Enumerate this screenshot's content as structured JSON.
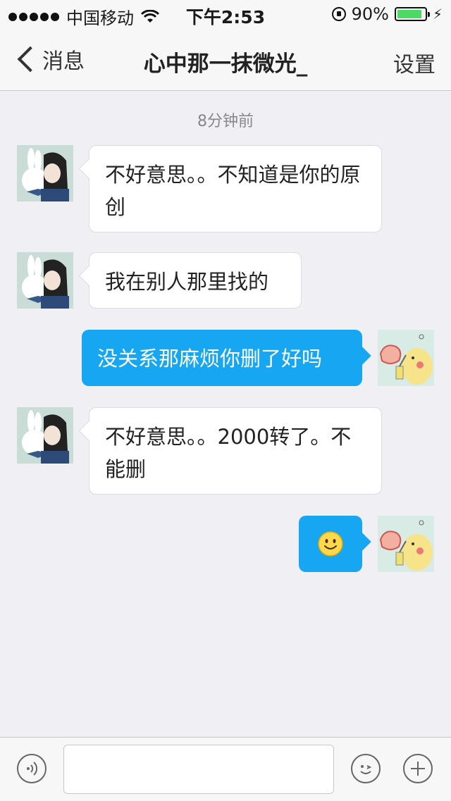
{
  "status_bar": {
    "carrier": "中国移动",
    "time": "下午2:53",
    "battery_percent": "90%",
    "battery_level": 0.9
  },
  "nav": {
    "back_label": "消息",
    "title": "心中那一抹微光_",
    "right_label": "设置"
  },
  "chat": {
    "timestamp": "8分钟前",
    "messages": [
      {
        "side": "in",
        "text": "不好意思。。不知道是你的原创"
      },
      {
        "side": "in",
        "text": "我在别人那里找的"
      },
      {
        "side": "out",
        "text": "没关系那麻烦你删了好吗"
      },
      {
        "side": "in",
        "text": "不好意思。。2000转了。不能删"
      },
      {
        "side": "out",
        "emoji": "smiley-emoji"
      }
    ]
  },
  "input_bar": {
    "voice_icon": "voice-icon",
    "emoji_icon": "emoji-icon",
    "plus_icon": "plus-icon"
  },
  "colors": {
    "outgoing_bubble": "#16a6f2",
    "incoming_bubble": "#ffffff",
    "background": "#efeff4"
  }
}
